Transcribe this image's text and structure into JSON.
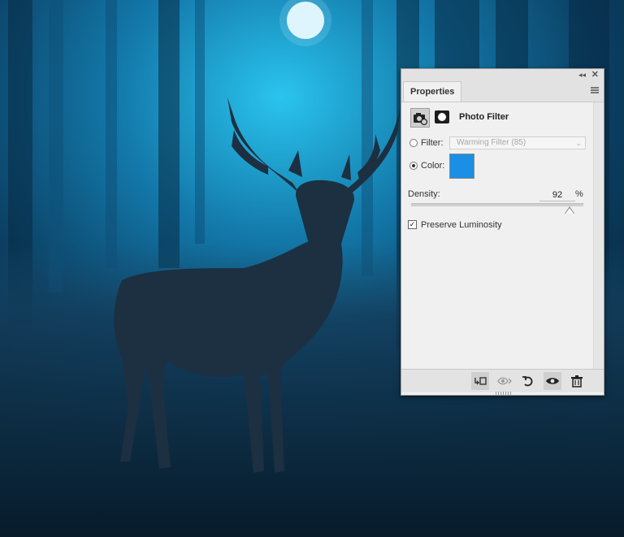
{
  "panel": {
    "tab_label": "Properties",
    "adjustment_title": "Photo Filter",
    "filter": {
      "label": "Filter:",
      "value": "Warming Filter (85)",
      "selected": false
    },
    "color": {
      "label": "Color:",
      "selected": true,
      "swatch_hex": "#1a8fe3"
    },
    "density": {
      "label": "Density:",
      "value": "92",
      "unit": "%",
      "slider_percent": 92
    },
    "preserve_luminosity": {
      "label": "Preserve Luminosity",
      "checked": true
    },
    "icons": {
      "titlebar": [
        "collapse-icon",
        "close-icon"
      ],
      "menu": "panel-menu-icon",
      "header": [
        "adjustment-icon",
        "layer-mask-icon"
      ],
      "bottom": [
        "clip-to-layer-icon",
        "view-previous-icon",
        "reset-icon",
        "toggle-visibility-icon",
        "trash-icon"
      ]
    }
  },
  "colors": {
    "panel_bg": "#f0f0f0",
    "accent_swatch": "#1a8fe3"
  }
}
